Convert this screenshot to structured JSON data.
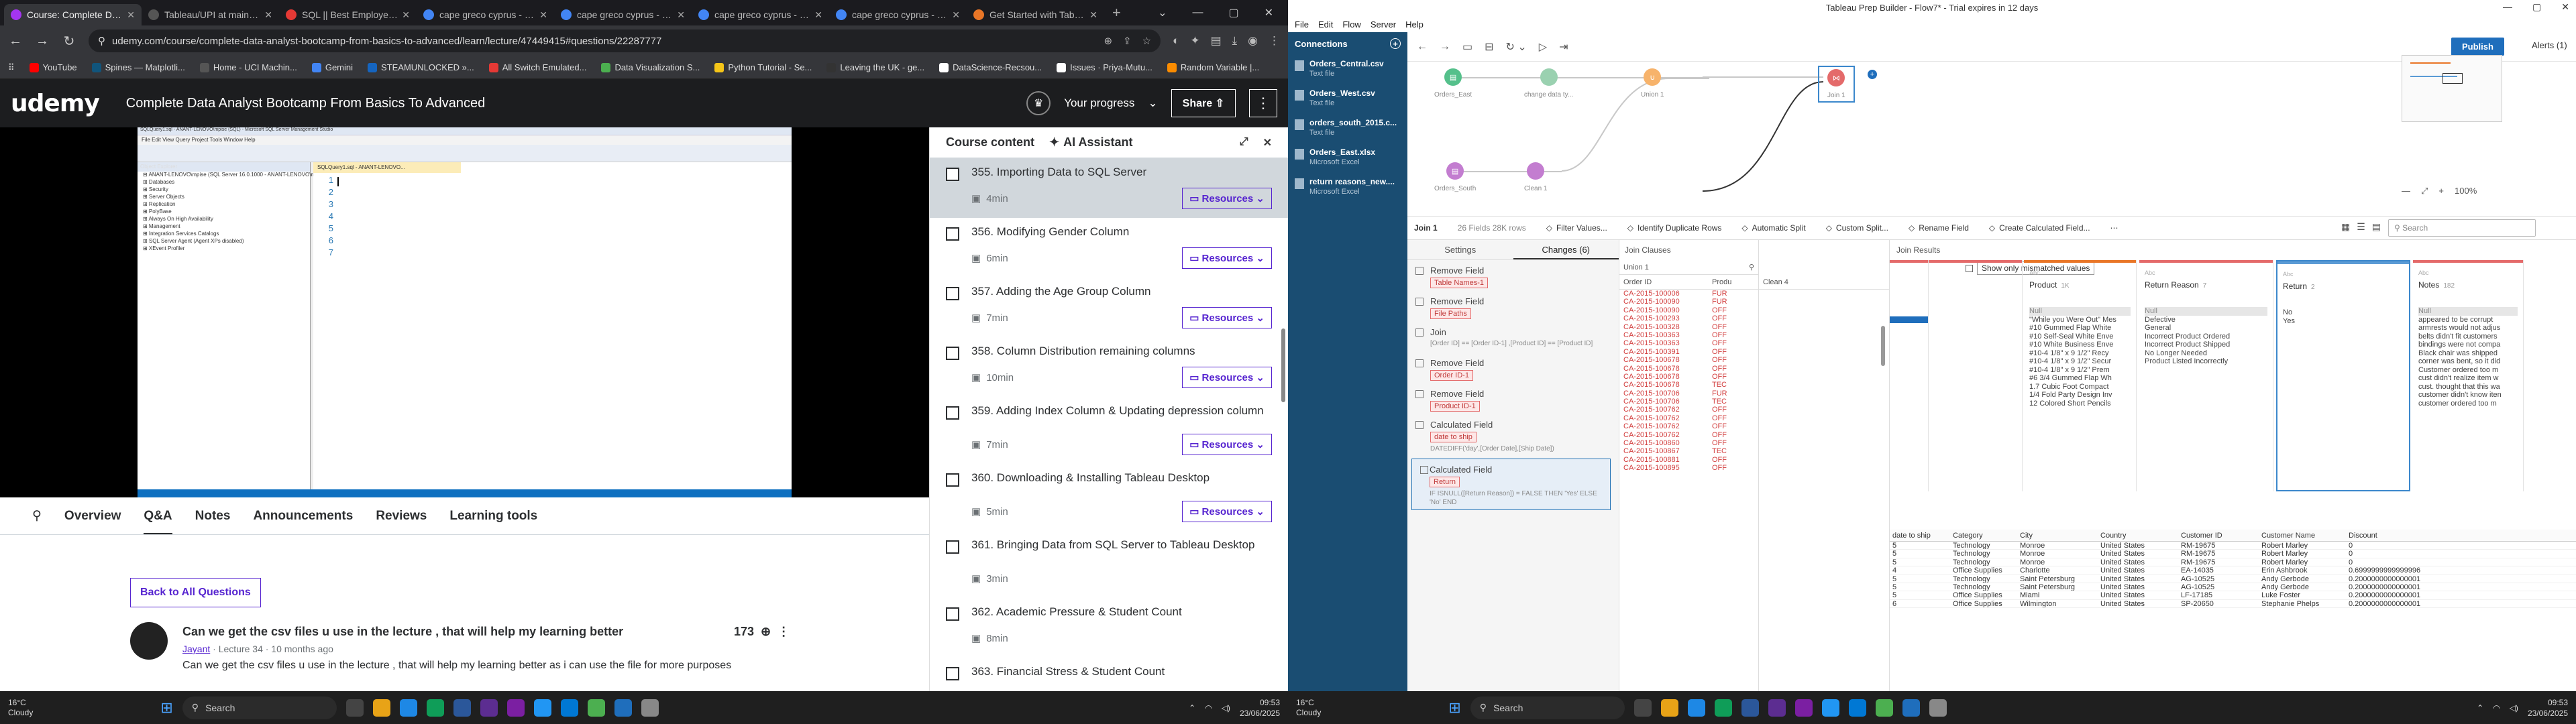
{
  "chrome": {
    "tabs": [
      {
        "title": "Course: Complete Data Analyst",
        "active": true,
        "fav_color": "#a435f0"
      },
      {
        "title": "Tableau/UPI at main · ku",
        "fav_color": "#555"
      },
      {
        "title": "SQL || Best Employee Ana",
        "fav_color": "#e53935"
      },
      {
        "title": "cape greco cyprus - Sear",
        "fav_color": "#4285f4"
      },
      {
        "title": "cape greco cyprus - Sear",
        "fav_color": "#4285f4"
      },
      {
        "title": "cape greco cyprus - Sear",
        "fav_color": "#4285f4"
      },
      {
        "title": "cape greco cyprus - Sear",
        "fav_color": "#4285f4"
      },
      {
        "title": "Get Started with Tableau",
        "fav_color": "#e97627"
      }
    ],
    "url": "udemy.com/course/complete-data-analyst-bootcamp-from-basics-to-advanced/learn/lecture/47449415#questions/22287777",
    "bookmarks": [
      {
        "label": "YouTube",
        "color": "#ff0000"
      },
      {
        "label": "Spines — Matplotli...",
        "color": "#11557c"
      },
      {
        "label": "Home - UCI Machin...",
        "color": "#555"
      },
      {
        "label": "Gemini",
        "color": "#4285f4"
      },
      {
        "label": "STEAMUNLOCKED »...",
        "color": "#1565c0"
      },
      {
        "label": "All Switch Emulated...",
        "color": "#e53935"
      },
      {
        "label": "Data Visualization S...",
        "color": "#4caf50"
      },
      {
        "label": "Python Tutorial - Se...",
        "color": "#f5c518"
      },
      {
        "label": "Leaving the UK - ge...",
        "color": "#333"
      },
      {
        "label": "DataScience-Recsou...",
        "color": "#fff"
      },
      {
        "label": "Issues · Priya-Mutu...",
        "color": "#fff"
      },
      {
        "label": "Random Variable |...",
        "color": "#fb8c00"
      }
    ]
  },
  "udemy": {
    "logo": "udemy",
    "course_title": "Complete Data Analyst Bootcamp From Basics To Advanced",
    "progress_label": "Your progress",
    "share_label": "Share",
    "course_content": {
      "title": "Course content",
      "ai_label": "AI Assistant",
      "lessons": [
        {
          "title": "355. Importing Data to SQL Server",
          "duration": "4min",
          "resources": true,
          "active": true
        },
        {
          "title": "356. Modifying Gender Column",
          "duration": "6min",
          "resources": true
        },
        {
          "title": "357. Adding the Age Group Column",
          "duration": "7min",
          "resources": true
        },
        {
          "title": "358. Column Distribution remaining columns",
          "duration": "10min",
          "resources": true
        },
        {
          "title": "359. Adding Index Column & Updating depression column",
          "duration": "7min",
          "resources": true
        },
        {
          "title": "360. Downloading & Installing Tableau Desktop",
          "duration": "5min",
          "resources": true
        },
        {
          "title": "361. Bringing Data from SQL Server to Tableau Desktop",
          "duration": "3min",
          "resources": false
        },
        {
          "title": "362. Academic Pressure & Student Count",
          "duration": "8min",
          "resources": false
        },
        {
          "title": "363. Financial Stress & Student Count",
          "duration": "",
          "resources": false
        }
      ],
      "resources_label": "Resources"
    },
    "tabs": [
      "Overview",
      "Q&A",
      "Notes",
      "Announcements",
      "Reviews",
      "Learning tools"
    ],
    "back_label": "Back to All Questions",
    "question": {
      "title": "Can we get the csv files u use in the lecture , that will help my learning better",
      "author": "Jayant",
      "lecture": "· Lecture 34 ·",
      "age": "10 months ago",
      "votes": "173",
      "body": "Can we get the csv files u use in the lecture , that will help my learning better as i can use the file for more purposes"
    },
    "ssms_title": "SQLQuery1.sql - ANANT-LENOVO\\mpise (SQL) - Microsoft SQL Server Management Studio",
    "ssms_menu": "File  Edit  View  Query  Project  Tools  Window  Help",
    "ssms_tree": [
      "ANANT-LENOVO\\mpise (SQL Server 16.0.1000 - ANANT-LENOVO\\mpise)",
      "Databases",
      "Security",
      "Server Objects",
      "Replication",
      "PolyBase",
      "Always On High Availability",
      "Management",
      "Integration Services Catalogs",
      "SQL Server Agent (Agent XPs disabled)",
      "XEvent Profiler"
    ],
    "ssms_lines": [
      "1",
      "2",
      "3",
      "4",
      "5",
      "6",
      "7"
    ]
  },
  "taskbar_left": {
    "temp": "16°C",
    "weather": "Cloudy",
    "search": "Search",
    "time": "09:53",
    "date": "23/06/2025"
  },
  "taskbar_right": {
    "temp": "16°C",
    "weather": "Cloudy",
    "search": "Search",
    "time": "09:53",
    "date": "23/06/2025"
  },
  "prep": {
    "window_title": "Tableau Prep Builder - Flow7* - Trial expires in 12 days",
    "menu": [
      "File",
      "Edit",
      "Flow",
      "Server",
      "Help"
    ],
    "connections_label": "Connections",
    "connections": [
      {
        "name": "Orders_Central.csv",
        "type": "Text file"
      },
      {
        "name": "Orders_West.csv",
        "type": "Text file"
      },
      {
        "name": "orders_south_2015.c...",
        "type": "Text file"
      },
      {
        "name": "Orders_East.xlsx",
        "type": "Microsoft Excel"
      },
      {
        "name": "return reasons_new....",
        "type": "Microsoft Excel"
      }
    ],
    "publish": "Publish",
    "alerts": "Alerts (1)",
    "zoom": "100%",
    "flow_nodes": [
      {
        "label": "Orders_East",
        "color": "#55c08b",
        "icon": "▤"
      },
      {
        "label": "change data ty...",
        "color": "#9ad1b0",
        "icon": ""
      },
      {
        "label": "Union 1",
        "color": "#f7b36b",
        "icon": "∪"
      },
      {
        "label": "Join 1",
        "color": "#e46a6a",
        "icon": "⋈"
      },
      {
        "label": "Orders_South",
        "color": "#c37dd0",
        "icon": "▤"
      },
      {
        "label": "Clean 1",
        "color": "#c37dd0",
        "icon": ""
      }
    ],
    "stepbar": {
      "name": "Join 1",
      "info": "26 Fields  28K rows",
      "actions": [
        "Filter Values...",
        "Identify Duplicate Rows",
        "Automatic Split",
        "Custom Split...",
        "Rename Field",
        "Create Calculated Field..."
      ],
      "search": "Search"
    },
    "changes_tabs": [
      "Settings",
      "Changes (6)"
    ],
    "changes": [
      {
        "title": "Remove Field",
        "tag": "Table Names-1",
        "expr": ""
      },
      {
        "title": "Remove Field",
        "tag": "File Paths",
        "expr": ""
      },
      {
        "title": "Join",
        "tag": "",
        "expr": "[Order ID] == [Order ID-1] ,[Product ID] == [Product ID]"
      },
      {
        "title": "Remove Field",
        "tag": "Order ID-1",
        "expr": ""
      },
      {
        "title": "Remove Field",
        "tag": "Product ID-1",
        "expr": ""
      },
      {
        "title": "Calculated Field",
        "tag": "date to ship",
        "expr": "DATEDIFF('day',[Order Date],[Ship Date])"
      },
      {
        "title": "Calculated Field",
        "tag": "Return",
        "expr": "IF ISNULL([Return Reason]) = FALSE THEN 'Yes' ELSE 'No' END",
        "selected": true
      }
    ],
    "join_clauses": {
      "label": "Join Clauses",
      "checkbox": "Show only mismatched values",
      "union_col": "Union 1",
      "clean_col": "Clean 4",
      "headers": [
        "Order ID",
        "Produ"
      ],
      "rows": [
        [
          "CA-2015-100006",
          "FUR"
        ],
        [
          "CA-2015-100090",
          "FUR"
        ],
        [
          "CA-2015-100090",
          "OFF"
        ],
        [
          "CA-2015-100293",
          "OFF"
        ],
        [
          "CA-2015-100328",
          "OFF"
        ],
        [
          "CA-2015-100363",
          "OFF"
        ],
        [
          "CA-2015-100363",
          "OFF"
        ],
        [
          "CA-2015-100391",
          "OFF"
        ],
        [
          "CA-2015-100678",
          "OFF"
        ],
        [
          "CA-2015-100678",
          "OFF"
        ],
        [
          "CA-2015-100678",
          "OFF"
        ],
        [
          "CA-2015-100678",
          "TEC"
        ],
        [
          "CA-2015-100706",
          "FUR"
        ],
        [
          "CA-2015-100706",
          "TEC"
        ],
        [
          "CA-2015-100762",
          "OFF"
        ],
        [
          "CA-2015-100762",
          "OFF"
        ],
        [
          "CA-2015-100762",
          "OFF"
        ],
        [
          "CA-2015-100762",
          "OFF"
        ],
        [
          "CA-2015-100860",
          "OFF"
        ],
        [
          "CA-2015-100867",
          "TEC"
        ],
        [
          "CA-2015-100881",
          "OFF"
        ],
        [
          "CA-2015-100895",
          "OFF"
        ]
      ]
    },
    "join_results_label": "Join Results",
    "profiles": [
      {
        "type": "Abc",
        "name": "Product",
        "count": "1K",
        "color": "#e97627",
        "values": [
          "Null",
          "\"While you Were Out\" Mes",
          "#10 Gummed Flap White",
          "#10 Self-Seal White Enve",
          "#10 White Business Enve",
          "#10-4 1/8\" x 9 1/2\" Recy",
          "#10-4 1/8\" x 9 1/2\" Secur",
          "#10-4 1/8\" x 9 1/2\" Prem",
          "#6 3/4 Gummed Flap Wh",
          "1.7 Cubic Foot Compact",
          "1/4 Fold Party Design Inv",
          "12 Colored Short Pencils"
        ]
      },
      {
        "type": "Abc",
        "name": "Return Reason",
        "count": "7",
        "color": "#e46a6a",
        "values": [
          "Null",
          "Defective",
          "General",
          "Incorrect Product Ordered",
          "Incorrect Product Shipped",
          "No Longer Needed",
          "Product Listed Incorrectly"
        ]
      },
      {
        "type": "Abc",
        "name": "Return",
        "count": "2",
        "color": "#5b9bd5",
        "values": [
          "No",
          "Yes"
        ]
      },
      {
        "type": "Abc",
        "name": "Notes",
        "count": "182",
        "color": "#e46a6a",
        "values": [
          "Null",
          "appeared to be corrupt",
          "armrests would not adjus",
          "belts didn't fit customers",
          "bindings were not compa",
          "Black chair was shipped",
          "corner was bent, so it did",
          "Customer ordered too m",
          "cust didn't realize item w",
          "cust. thought that this wa",
          "customer didn't know iten",
          "customer ordered too m"
        ]
      }
    ],
    "grid": {
      "headers": [
        "date to ship",
        "Category",
        "City",
        "Country",
        "Customer ID",
        "Customer Name",
        "Discount"
      ],
      "rows": [
        [
          "5",
          "Technology",
          "Monroe",
          "United States",
          "RM-19675",
          "Robert Marley",
          "0"
        ],
        [
          "5",
          "Technology",
          "Monroe",
          "United States",
          "RM-19675",
          "Robert Marley",
          "0"
        ],
        [
          "5",
          "Technology",
          "Monroe",
          "United States",
          "RM-19675",
          "Robert Marley",
          "0"
        ],
        [
          "4",
          "Office Supplies",
          "Charlotte",
          "United States",
          "EA-14035",
          "Erin Ashbrook",
          "0.6999999999999996"
        ],
        [
          "5",
          "Technology",
          "Saint Petersburg",
          "United States",
          "AG-10525",
          "Andy Gerbode",
          "0.2000000000000001"
        ],
        [
          "5",
          "Technology",
          "Saint Petersburg",
          "United States",
          "AG-10525",
          "Andy Gerbode",
          "0.2000000000000001"
        ],
        [
          "5",
          "Office Supplies",
          "Miami",
          "United States",
          "LF-17185",
          "Luke Foster",
          "0.2000000000000001"
        ],
        [
          "6",
          "Office Supplies",
          "Wilmington",
          "United States",
          "SP-20650",
          "Stephanie Phelps",
          "0.2000000000000001"
        ]
      ]
    }
  }
}
